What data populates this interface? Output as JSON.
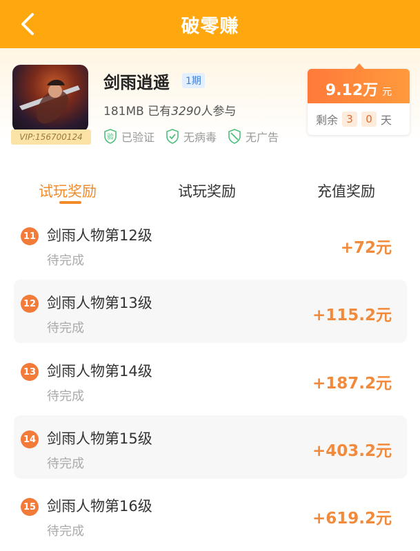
{
  "header": {
    "title": "破零赚"
  },
  "app": {
    "name": "剑雨逍遥",
    "period": "1期",
    "size": "181MB",
    "participants_prefix": "已有",
    "participants_count": "3290",
    "participants_suffix": "人参与",
    "vip_label": "VIP:156700124",
    "badges": [
      {
        "icon": "verified-icon",
        "label": "已验证"
      },
      {
        "icon": "shield-check-icon",
        "label": "无病毒"
      },
      {
        "icon": "shield-slash-icon",
        "label": "无广告"
      }
    ]
  },
  "reward_card": {
    "amount": "9.12万",
    "unit": "元",
    "remaining_label": "剩余",
    "days_digit_1": "3",
    "days_digit_2": "0",
    "days_unit": "天"
  },
  "tabs": [
    {
      "label": "试玩奖励",
      "active": true
    },
    {
      "label": "试玩奖励",
      "active": false
    },
    {
      "label": "充值奖励",
      "active": false
    }
  ],
  "tasks": [
    {
      "num": "11",
      "title": "剑雨人物第12级",
      "status": "待完成",
      "reward": "+72元"
    },
    {
      "num": "12",
      "title": "剑雨人物第13级",
      "status": "待完成",
      "reward": "+115.2元"
    },
    {
      "num": "13",
      "title": "剑雨人物第14级",
      "status": "待完成",
      "reward": "+187.2元"
    },
    {
      "num": "14",
      "title": "剑雨人物第15级",
      "status": "待完成",
      "reward": "+403.2元"
    },
    {
      "num": "15",
      "title": "剑雨人物第16级",
      "status": "待完成",
      "reward": "+619.2元"
    }
  ],
  "colors": {
    "header": "#ffa70f",
    "accent": "#f28a28",
    "reward": "#f28a3c"
  }
}
